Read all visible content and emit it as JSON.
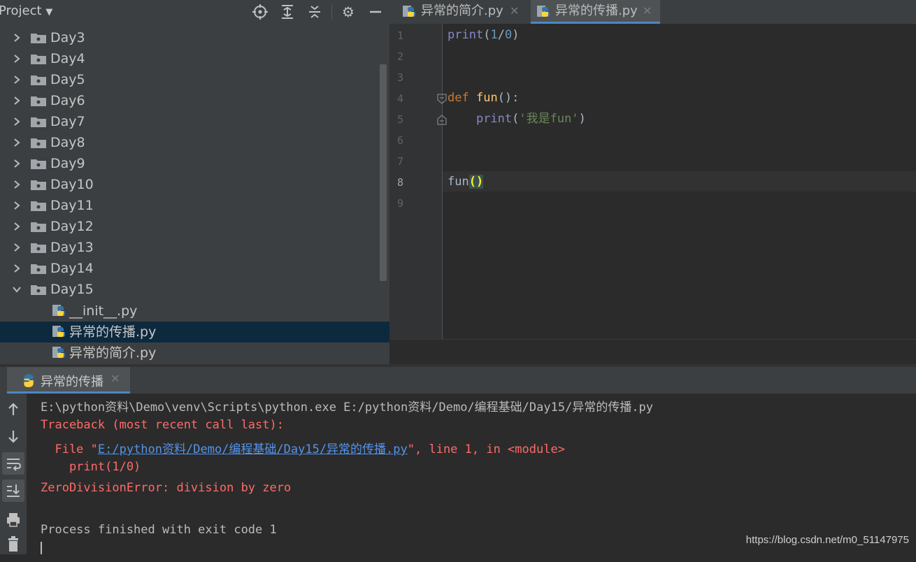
{
  "project": {
    "title": "Project",
    "tree": [
      {
        "label": "Day3"
      },
      {
        "label": "Day4"
      },
      {
        "label": "Day5"
      },
      {
        "label": "Day6"
      },
      {
        "label": "Day7"
      },
      {
        "label": "Day8"
      },
      {
        "label": "Day9"
      },
      {
        "label": "Day10"
      },
      {
        "label": "Day11"
      },
      {
        "label": "Day12"
      },
      {
        "label": "Day13"
      },
      {
        "label": "Day14"
      },
      {
        "label": "Day15"
      }
    ],
    "files": [
      {
        "label": "__init__.py"
      },
      {
        "label": "异常的传播.py",
        "selected": true
      },
      {
        "label": "异常的简介.py"
      }
    ]
  },
  "editor": {
    "tabs": [
      {
        "label": "异常的简介.py",
        "active": false
      },
      {
        "label": "异常的传播.py",
        "active": true
      }
    ],
    "line_numbers": [
      "1",
      "2",
      "3",
      "4",
      "5",
      "6",
      "7",
      "8",
      "9"
    ],
    "current_line": "8",
    "code": {
      "line1": {
        "fn": "print",
        "open": "(",
        "n1": "1",
        "slash": "/",
        "n2": "0",
        "close": ")"
      },
      "line4": {
        "kw": "def",
        "name": "fun",
        "rest": "():"
      },
      "line5": {
        "fn": "print",
        "open": "(",
        "str": "'我是fun'",
        "close": ")"
      },
      "line8": {
        "name": "fun",
        "parens": "()"
      }
    }
  },
  "run": {
    "tab_label": "异常的传播",
    "console": {
      "cmd": "E:\\python资料\\Demo\\venv\\Scripts\\python.exe E:/python资料/Demo/编程基础/Day15/异常的传播.py",
      "traceback": "Traceback (most recent call last):",
      "file_prefix": "  File \"",
      "file_link": "E:/python资料/Demo/编程基础/Day15/异常的传播.py",
      "file_suffix": "\", line 1, in <module>",
      "code_line": "    print(1/0)",
      "error": "ZeroDivisionError: division by zero",
      "finished": "Process finished with exit code 1"
    }
  },
  "watermark": "https://blog.csdn.net/m0_51147975",
  "colors": {
    "selection": "#0d293e",
    "accent": "#4a88c7",
    "error": "#ff6b68",
    "link": "#5394ec"
  }
}
